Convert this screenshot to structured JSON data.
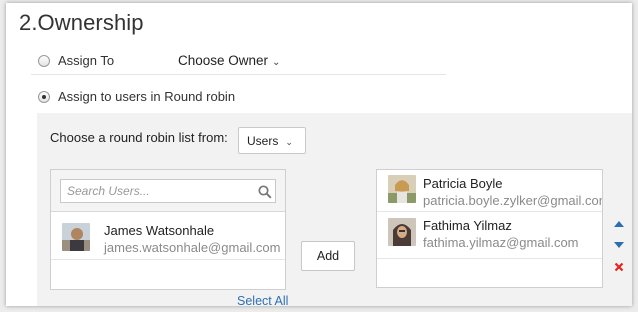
{
  "section": {
    "title": "2.Ownership"
  },
  "assign_to": {
    "label": "Assign To",
    "owner_dropdown": "Choose Owner",
    "selected": false
  },
  "round_robin": {
    "label": "Assign to users in Round robin",
    "selected": true
  },
  "round_robin_list": {
    "prompt": "Choose a round robin list from:",
    "selected_list": "Users"
  },
  "available_users": {
    "search_placeholder": "Search Users...",
    "users": [
      {
        "name": "James Watsonhale",
        "email": "james.watsonhale@gmail.com"
      }
    ],
    "select_all_label": "Select All"
  },
  "add_button_label": "Add",
  "selected_users": [
    {
      "name": "Patricia Boyle",
      "email": "patricia.boyle.zylker@gmail.com"
    },
    {
      "name": "Fathima Yilmaz",
      "email": "fathima.yilmaz@gmail.com"
    }
  ],
  "icons": [
    "search-icon",
    "chevron-down-icon",
    "move-up-icon",
    "move-down-icon",
    "remove-icon"
  ],
  "colors": {
    "link": "#2f6fb7",
    "arrow": "#2c6fb1",
    "remove": "#e0281f",
    "panel": "#f2f2f2"
  }
}
